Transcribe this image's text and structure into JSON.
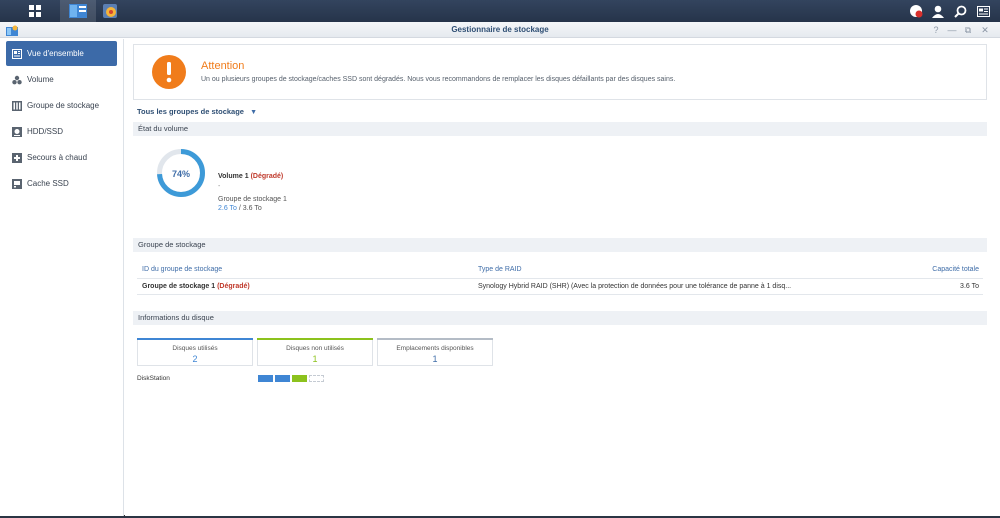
{
  "taskbar": {
    "icons": [
      "main-menu-icon",
      "storage-manager-taskbar-icon",
      "control-panel-taskbar-icon"
    ],
    "right_icons": [
      "notification-icon",
      "user-icon",
      "search-icon",
      "widgets-icon"
    ]
  },
  "window": {
    "title": "Gestionnaire de stockage",
    "controls": [
      "?",
      "—",
      "⧉",
      "✕"
    ]
  },
  "sidebar": {
    "items": [
      {
        "label": "Vue d'ensemble",
        "icon": "overview-icon"
      },
      {
        "label": "Volume",
        "icon": "volume-icon"
      },
      {
        "label": "Groupe de stockage",
        "icon": "storage-pool-icon"
      },
      {
        "label": "HDD/SSD",
        "icon": "hdd-icon"
      },
      {
        "label": "Secours à chaud",
        "icon": "hot-spare-icon"
      },
      {
        "label": "Cache SSD",
        "icon": "ssd-cache-icon"
      }
    ]
  },
  "alert": {
    "title": "Attention",
    "message": "Un ou plusieurs groupes de stockage/caches SSD sont dégradés. Nous vous recommandons de remplacer les disques défaillants par des disques sains.",
    "icon": "warning-icon",
    "color": "#f07c1b"
  },
  "filter": {
    "label": "Tous les groupes de stockage"
  },
  "volume_section": {
    "header": "État du volume",
    "usage_percent": 74,
    "usage_label": "74%",
    "name": "Volume 1",
    "status": "(Dégradé)",
    "dash": "-",
    "pool": "Groupe de stockage 1",
    "used": "2.6 To",
    "separator": " / ",
    "total": "3.6 To",
    "ring_color": "#3d9ad8",
    "ring_bg": "#e1e6ec"
  },
  "pool_section": {
    "header": "Groupe de stockage",
    "columns": [
      "ID du groupe de stockage",
      "Type de RAID",
      "Capacité totale"
    ],
    "rows": [
      {
        "id": "Groupe de stockage 1",
        "status": "(Dégradé)",
        "raid": "Synology Hybrid RAID (SHR) (Avec la protection de données pour une tolérance de panne à 1 disq...",
        "capacity": "3.6 To"
      }
    ]
  },
  "disk_section": {
    "header": "Informations du disque",
    "cards": [
      {
        "label": "Disques utilisés",
        "value": "2",
        "color": "#3f86d4"
      },
      {
        "label": "Disques non utilisés",
        "value": "1",
        "color": "#8cc21d"
      },
      {
        "label": "Emplacements disponibles",
        "value": "1",
        "color": "#b4bcc6"
      }
    ],
    "device": "DiskStation",
    "slots": [
      "used",
      "used",
      "unused",
      "empty"
    ]
  }
}
